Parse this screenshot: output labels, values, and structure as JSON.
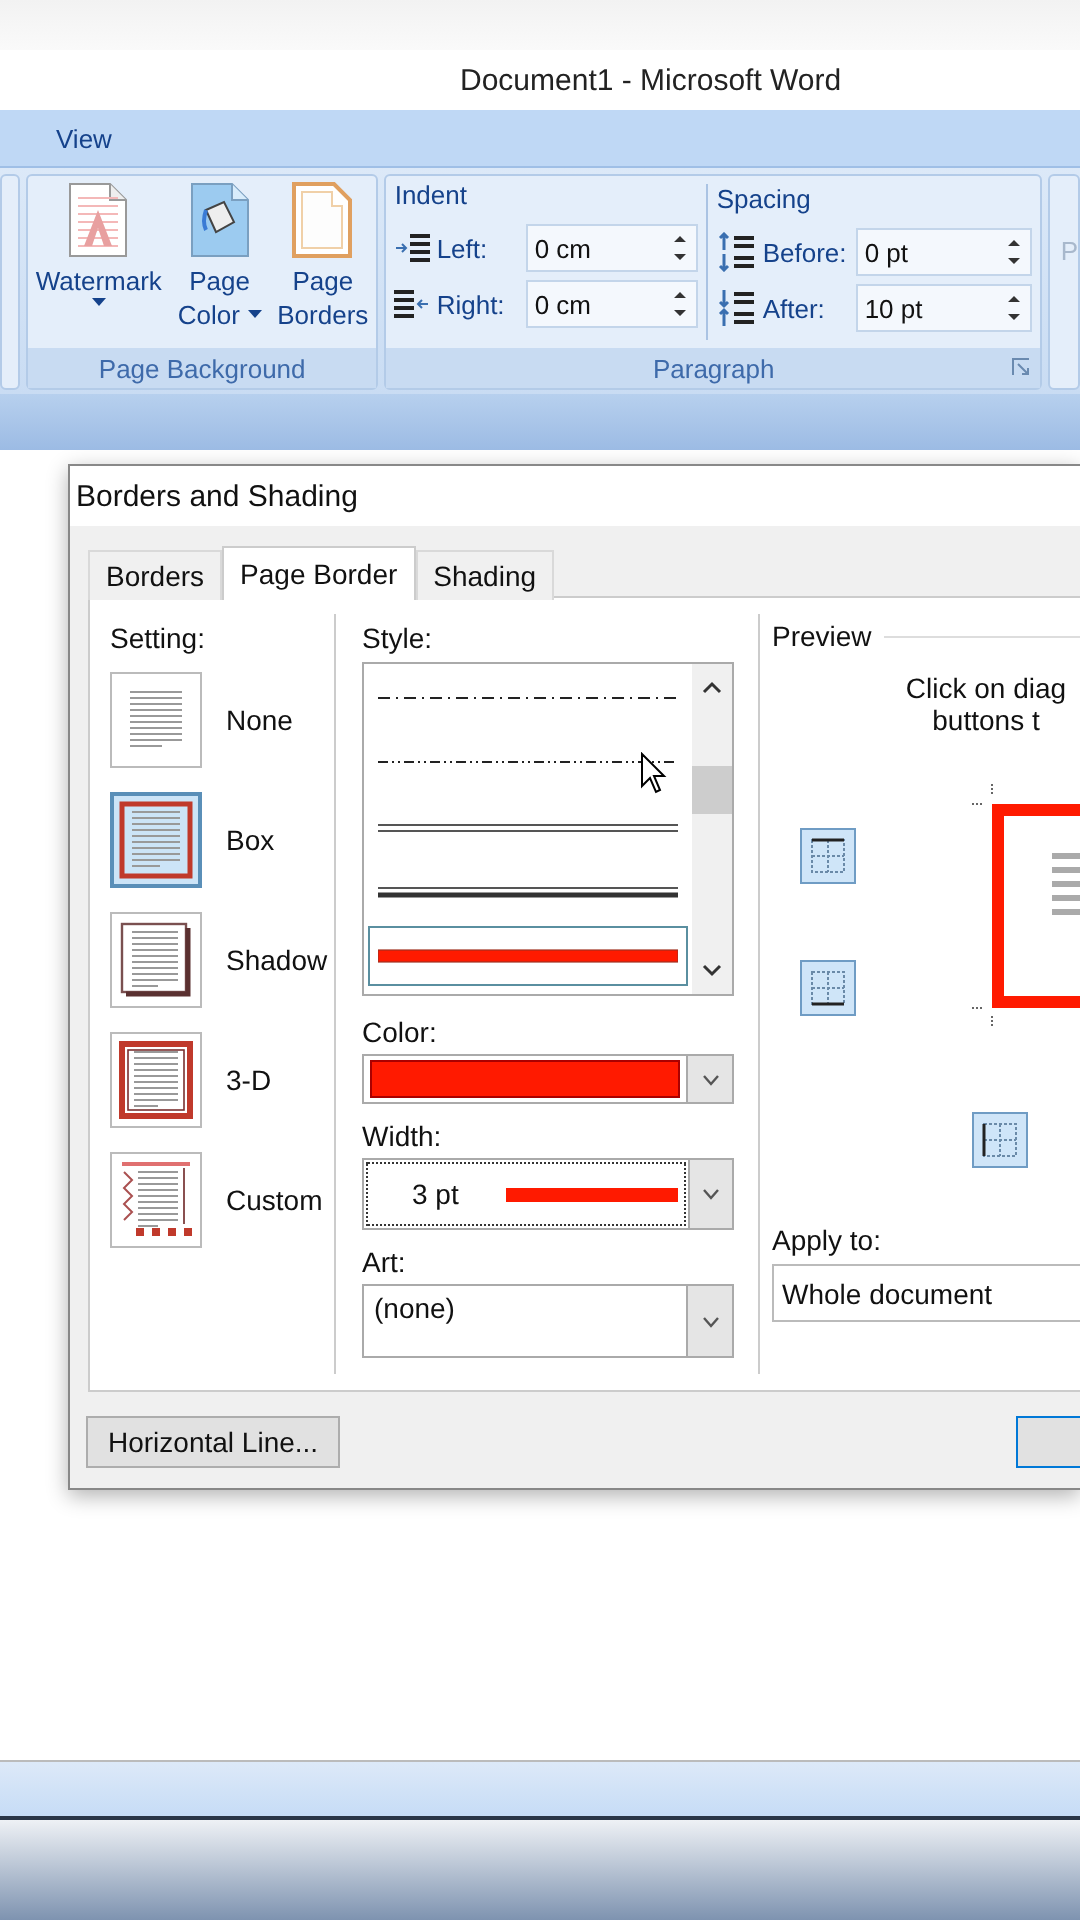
{
  "window": {
    "title": "Document1 - Microsoft Word"
  },
  "ribbon_tabs": [
    {
      "label": "View",
      "selected": false
    }
  ],
  "ribbon": {
    "page_background": {
      "label": "Page Background",
      "buttons": [
        {
          "kind": "watermark",
          "lines": [
            "Watermark"
          ],
          "dropdown": true
        },
        {
          "kind": "page-color",
          "lines": [
            "Page",
            "Color"
          ],
          "dropdown": true
        },
        {
          "kind": "page-borders",
          "lines": [
            "Page",
            "Borders"
          ],
          "dropdown": false
        }
      ]
    },
    "paragraph": {
      "label": "Paragraph",
      "sections": [
        {
          "kind": "indent",
          "title": "Indent",
          "fields": [
            {
              "kind": "left",
              "label": "Left:",
              "value": "0 cm"
            },
            {
              "kind": "right",
              "label": "Right:",
              "value": "0 cm"
            }
          ]
        },
        {
          "kind": "spacing",
          "title": "Spacing",
          "fields": [
            {
              "kind": "before",
              "label": "Before:",
              "value": "0 pt"
            },
            {
              "kind": "after",
              "label": "After:",
              "value": "10 pt"
            }
          ]
        }
      ]
    },
    "next_group": {
      "label": "P",
      "disabled": true
    }
  },
  "dialog": {
    "title": "Borders and Shading",
    "tabs": [
      {
        "label": "Borders",
        "selected": false
      },
      {
        "label": "Page Border",
        "selected": true
      },
      {
        "label": "Shading",
        "selected": false
      }
    ],
    "settings": {
      "label": "Setting:",
      "options": [
        {
          "kind": "none",
          "label": "None",
          "selected": false
        },
        {
          "kind": "box",
          "label": "Box",
          "selected": true
        },
        {
          "kind": "shadow",
          "label": "Shadow",
          "selected": false
        },
        {
          "kind": "relief",
          "label": "3-D",
          "selected": false
        },
        {
          "kind": "custom",
          "label": "Custom",
          "selected": false
        }
      ]
    },
    "style": {
      "label": "Style:",
      "items": [
        {
          "kind": "dash-dot",
          "selected": false
        },
        {
          "kind": "dash-dot-dot",
          "selected": false
        },
        {
          "kind": "double",
          "selected": false
        },
        {
          "kind": "thin-thick",
          "selected": false
        },
        {
          "kind": "thick",
          "selected": true
        }
      ]
    },
    "color": {
      "label": "Color:",
      "color": "#ff1a00"
    },
    "width": {
      "label": "Width:",
      "value": "3 pt"
    },
    "art": {
      "label": "Art:",
      "value": "(none)"
    },
    "preview": {
      "label": "Preview",
      "hint_lines": [
        "Click on diag",
        "buttons t"
      ]
    },
    "apply_to": {
      "label": "Apply to:",
      "value": "Whole document"
    },
    "buttons": [
      "Horizontal Line..."
    ]
  }
}
